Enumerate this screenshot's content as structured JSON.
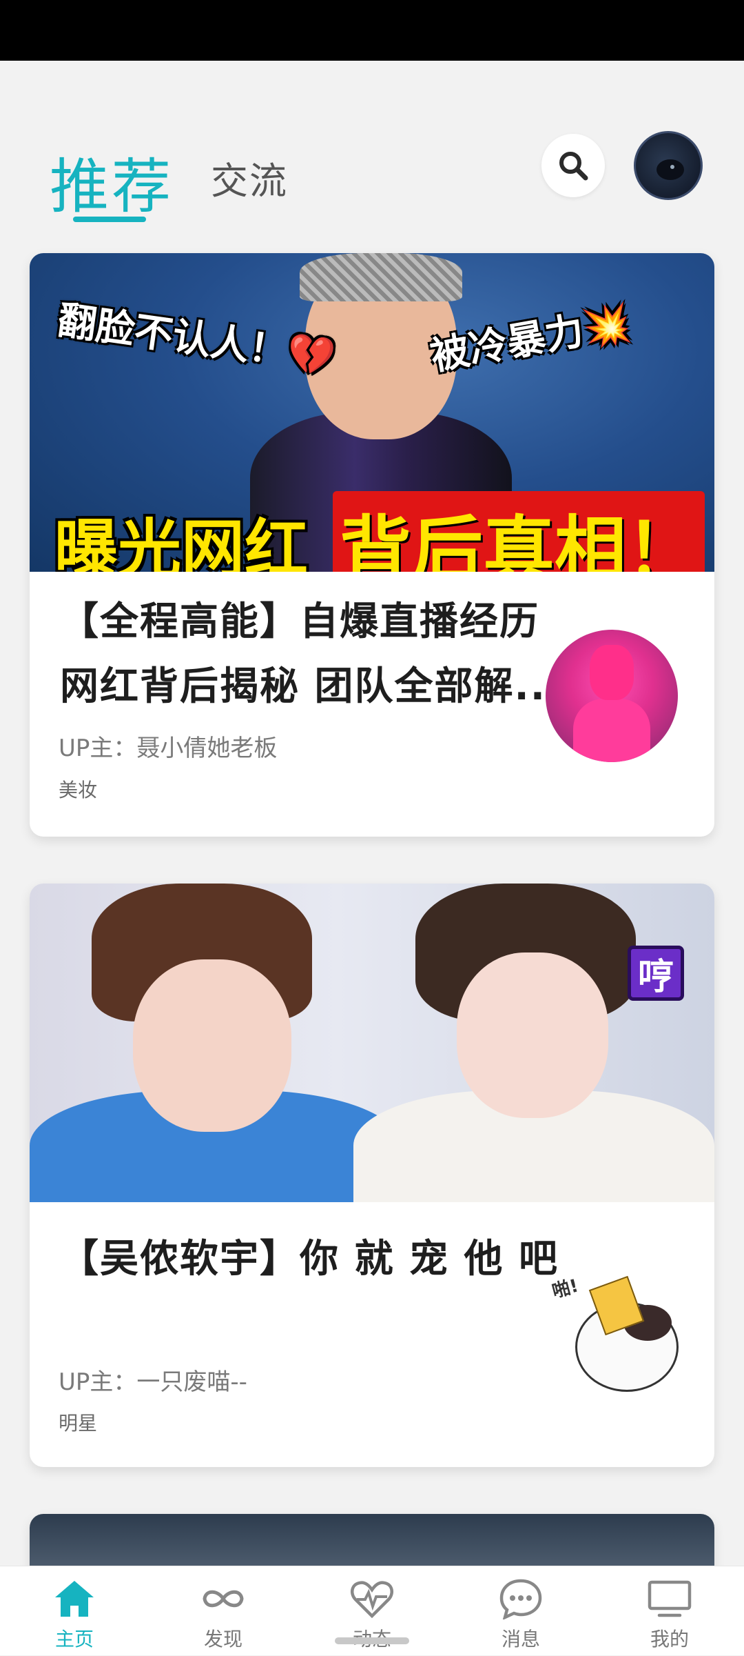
{
  "header": {
    "tabs": [
      {
        "label": "推荐",
        "active": true
      },
      {
        "label": "交流",
        "active": false
      }
    ],
    "accent_color": "#16b3c0",
    "search_icon": "search-icon",
    "avatar_icon": "user-avatar"
  },
  "feed": [
    {
      "thumbnail_captions": [
        "翻脸不认人！💔",
        "被冷暴力💥",
        "曝光网红",
        "背后真相！"
      ],
      "title_line1": "【全程高能】自爆直播经历",
      "title_line2": "网红背后揭秘 团队全部解...",
      "author": "UP主：聂小倩她老板",
      "category": "美妆"
    },
    {
      "thumbnail_captions": [
        "哼"
      ],
      "title_line1": "【吴侬软宇】你 就 宠 他 吧",
      "author": "UP主：一只废喵--",
      "category": "明星",
      "sticker_text": "啪!"
    }
  ],
  "bottom_nav": [
    {
      "label": "主页",
      "icon": "home-icon",
      "active": true
    },
    {
      "label": "发现",
      "icon": "infinity-icon",
      "active": false
    },
    {
      "label": "动态",
      "icon": "heartbeat-icon",
      "active": false
    },
    {
      "label": "消息",
      "icon": "message-icon",
      "active": false
    },
    {
      "label": "我的",
      "icon": "tv-icon",
      "active": false
    }
  ]
}
